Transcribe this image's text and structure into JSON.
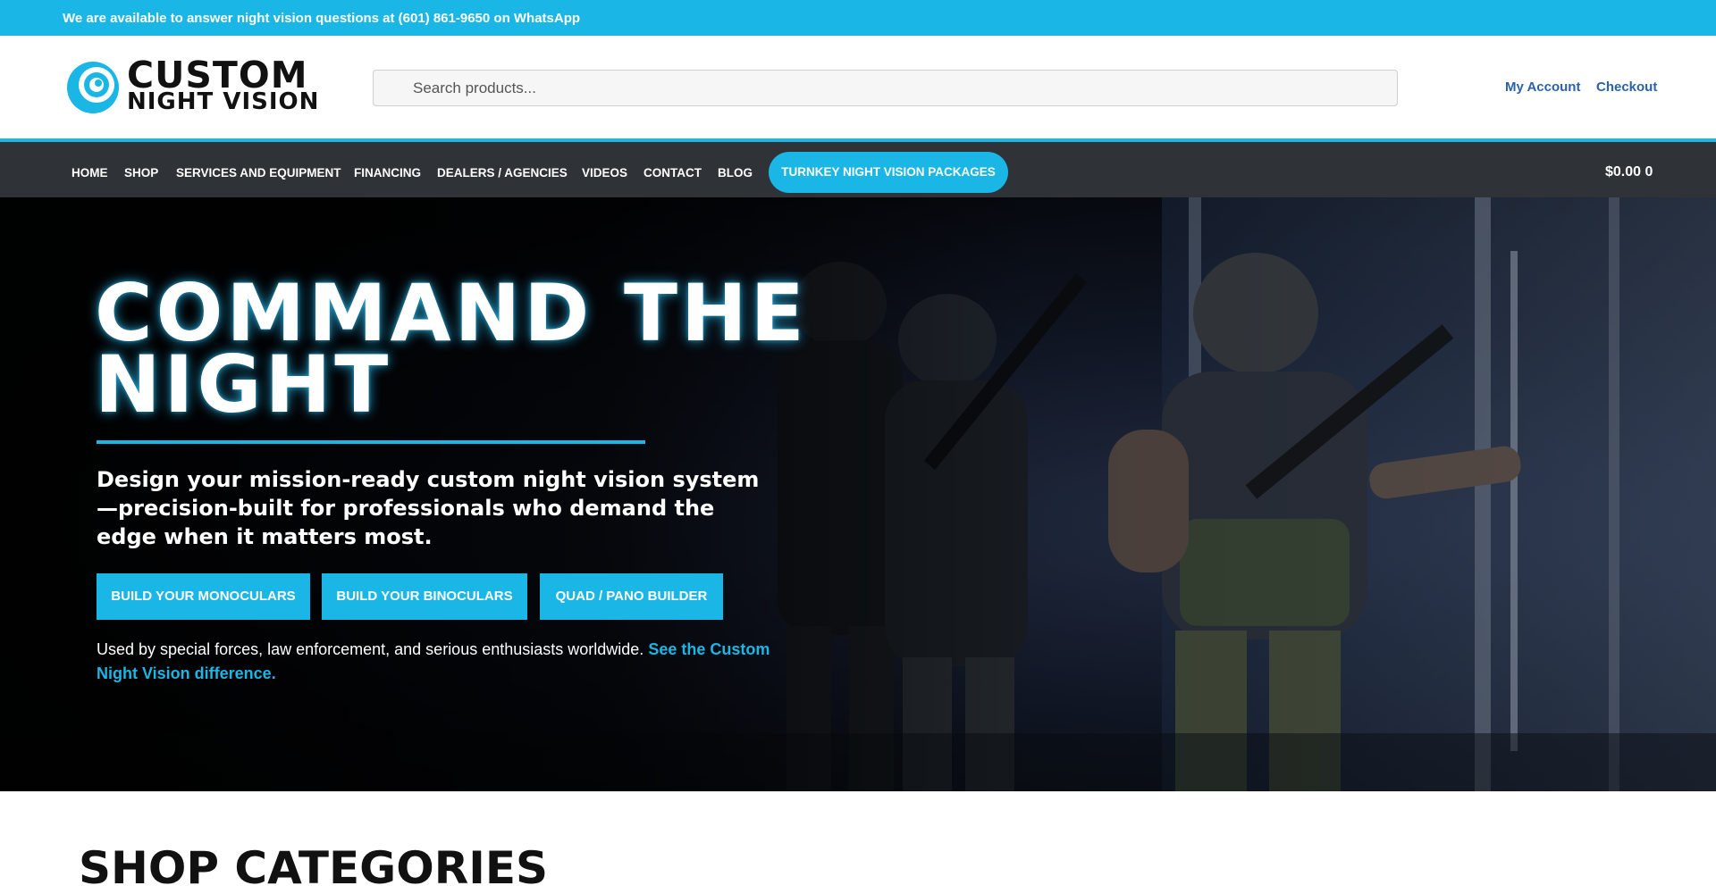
{
  "announcement": "We are available to answer night vision questions at (601) 861-9650 on WhatsApp",
  "logo": {
    "line1": "CUSTOM",
    "line2": "NIGHT VISION",
    "icon": "logo-eye-icon"
  },
  "search": {
    "placeholder": "Search products..."
  },
  "account_links": {
    "my_account": "My Account",
    "checkout": "Checkout"
  },
  "nav": {
    "items": [
      "HOME",
      "SHOP",
      "SERVICES AND EQUIPMENT",
      "FINANCING",
      "DEALERS / AGENCIES",
      "VIDEOS",
      "CONTACT",
      "BLOG"
    ],
    "cta": "TURNKEY NIGHT VISION PACKAGES",
    "cart": "$0.00 0"
  },
  "hero": {
    "title": "COMMAND THE NIGHT",
    "subtitle": "Design your mission-ready custom night vision system—precision-built for professionals who demand the edge when it matters most.",
    "buttons": [
      "BUILD YOUR MONOCULARS",
      "BUILD YOUR BINOCULARS",
      "QUAD / PANO BUILDER"
    ],
    "note": "Used by special forces, law enforcement, and serious enthusiasts worldwide.",
    "note_link": "See the Custom Night Vision difference."
  },
  "section": {
    "shop_categories": "SHOP CATEGORIES"
  },
  "colors": {
    "accent": "#1ab6e6",
    "nav_bg": "#2f3237",
    "link": "#2a63a8"
  }
}
